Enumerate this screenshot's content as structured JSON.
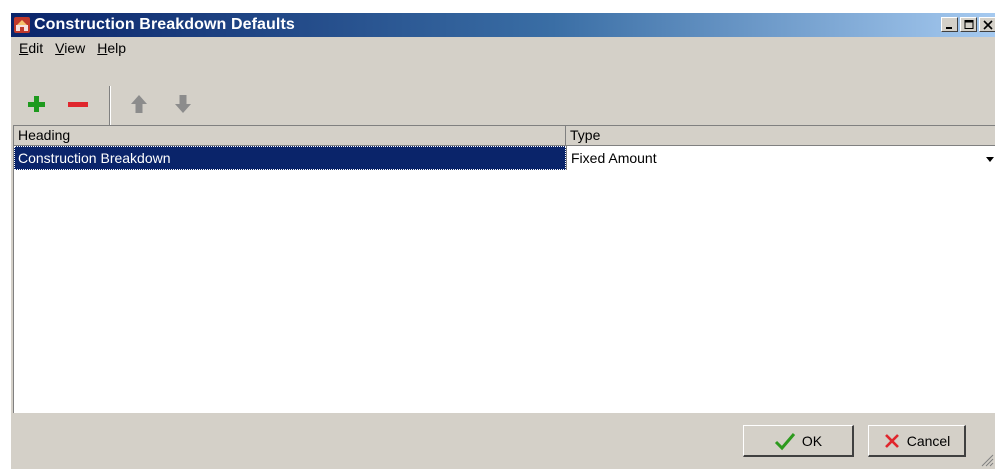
{
  "window": {
    "title": "Construction Breakdown Defaults"
  },
  "menu": [
    {
      "label_u": "E",
      "label_rest": "dit"
    },
    {
      "label_u": "V",
      "label_rest": "iew"
    },
    {
      "label_u": "H",
      "label_rest": "elp"
    }
  ],
  "toolbar": {
    "add_icon": "plus-icon",
    "remove_icon": "minus-icon",
    "up_icon": "arrow-up-icon",
    "down_icon": "arrow-down-icon"
  },
  "grid": {
    "columns": [
      "Heading",
      "Type"
    ],
    "rows": [
      {
        "heading": "Construction Breakdown",
        "type": "Fixed Amount"
      }
    ]
  },
  "buttons": {
    "ok": "OK",
    "cancel": "Cancel"
  },
  "colors": {
    "title_start": "#0a246a",
    "title_end": "#a6caf0",
    "selection": "#0a246a",
    "add_green": "#1e9a1e",
    "remove_red": "#e0262d"
  }
}
